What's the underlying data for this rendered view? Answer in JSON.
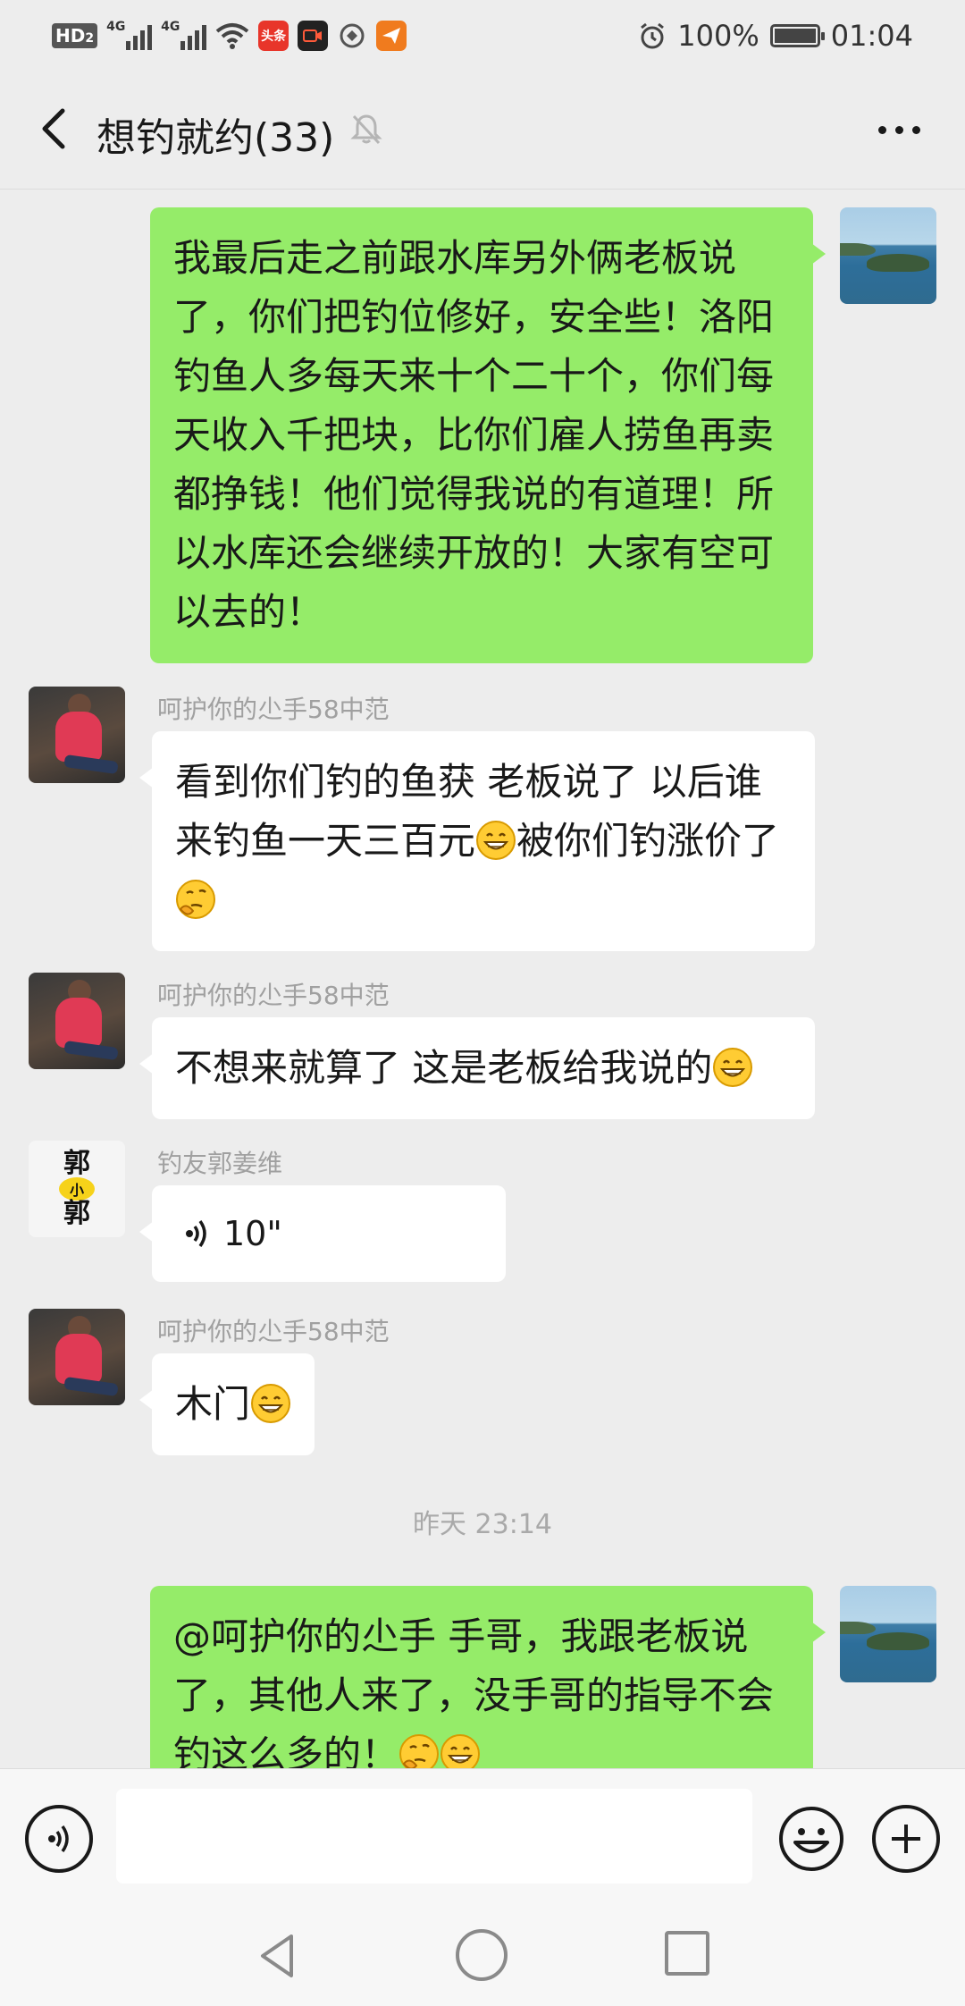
{
  "status_bar": {
    "hd_label": "HD",
    "hd_sub": "2",
    "network_1": "4G",
    "network_2": "4G",
    "toutiao_label": "头条",
    "battery_percent": "100%",
    "battery_level": 1.0,
    "time": "01:04"
  },
  "header": {
    "title": "想钓就约(33)"
  },
  "messages": [
    {
      "side": "right",
      "text": "我最后走之前跟水库另外俩老板说了，你们把钓位修好，安全些！洛阳钓鱼人多每天来十个二十个，你们每天收入千把块，比你们雇人捞鱼再卖都挣钱！他们觉得我说的有道理！所以水库还会继续开放的！大家有空可以去的！"
    },
    {
      "side": "left",
      "sender": "呵护你的尐手58中范",
      "text_a": "看到你们钓的鱼获 老板说了 以后谁来钓鱼一天三百元",
      "text_b": "被你们钓涨价了"
    },
    {
      "side": "left",
      "sender": "呵护你的尐手58中范",
      "text": "不想来就算了 这是老板给我说的"
    },
    {
      "side": "left",
      "sender": "钓友郭姜维",
      "avatar_text_top": "郭",
      "avatar_text_mid": "小",
      "avatar_text_bottom": "郭",
      "voice_duration": "10\""
    },
    {
      "side": "left",
      "sender": "呵护你的尐手58中范",
      "text": "木门"
    },
    {
      "time_divider": "昨天 23:14"
    },
    {
      "side": "right",
      "text": "@呵护你的尐手  手哥，我跟老板说了，其他人来了，没手哥的指导不会钓这么多的！"
    }
  ],
  "input": {
    "placeholder": ""
  },
  "colors": {
    "background": "#ededed",
    "bubble_self": "#95ec69",
    "bubble_other": "#ffffff",
    "sender_name": "#a0a0a0"
  }
}
